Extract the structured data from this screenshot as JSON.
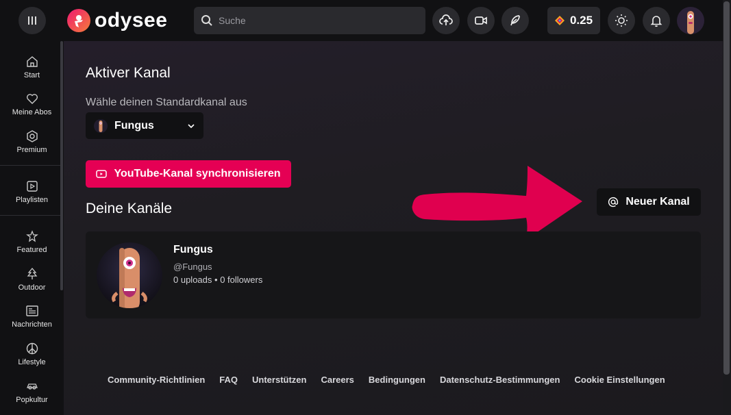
{
  "header": {
    "brand": "odysee",
    "search_placeholder": "Suche",
    "credits": "0.25"
  },
  "sidebar": {
    "items": [
      {
        "label": "Start",
        "icon": "home-icon"
      },
      {
        "label": "Meine Abos",
        "icon": "heart-icon"
      },
      {
        "label": "Premium",
        "icon": "premium-icon"
      },
      {
        "label": "Playlisten",
        "icon": "playlist-icon"
      },
      {
        "label": "Featured",
        "icon": "featured-icon"
      },
      {
        "label": "Outdoor",
        "icon": "tree-icon"
      },
      {
        "label": "Nachrichten",
        "icon": "news-icon"
      },
      {
        "label": "Lifestyle",
        "icon": "peace-icon"
      },
      {
        "label": "Popkultur",
        "icon": "popculture-icon"
      }
    ]
  },
  "main": {
    "active_channel_title": "Aktiver Kanal",
    "default_channel_label": "Wähle deinen Standardkanal aus",
    "selected_channel": "Fungus",
    "youtube_sync_label": "YouTube-Kanal synchronisieren",
    "your_channels_title": "Deine Kanäle",
    "new_channel_label": "Neuer Kanal",
    "channel": {
      "name": "Fungus",
      "handle": "@Fungus",
      "uploads": "0 uploads",
      "separator": "•",
      "followers": "0 followers"
    }
  },
  "footer": {
    "links": [
      "Community-Richtlinien",
      "FAQ",
      "Unterstützen",
      "Careers",
      "Bedingungen",
      "Datenschutz-Bestimmungen",
      "Cookie Einstellungen"
    ]
  },
  "colors": {
    "accent": "#e50054",
    "arrow": "#e0004f"
  }
}
